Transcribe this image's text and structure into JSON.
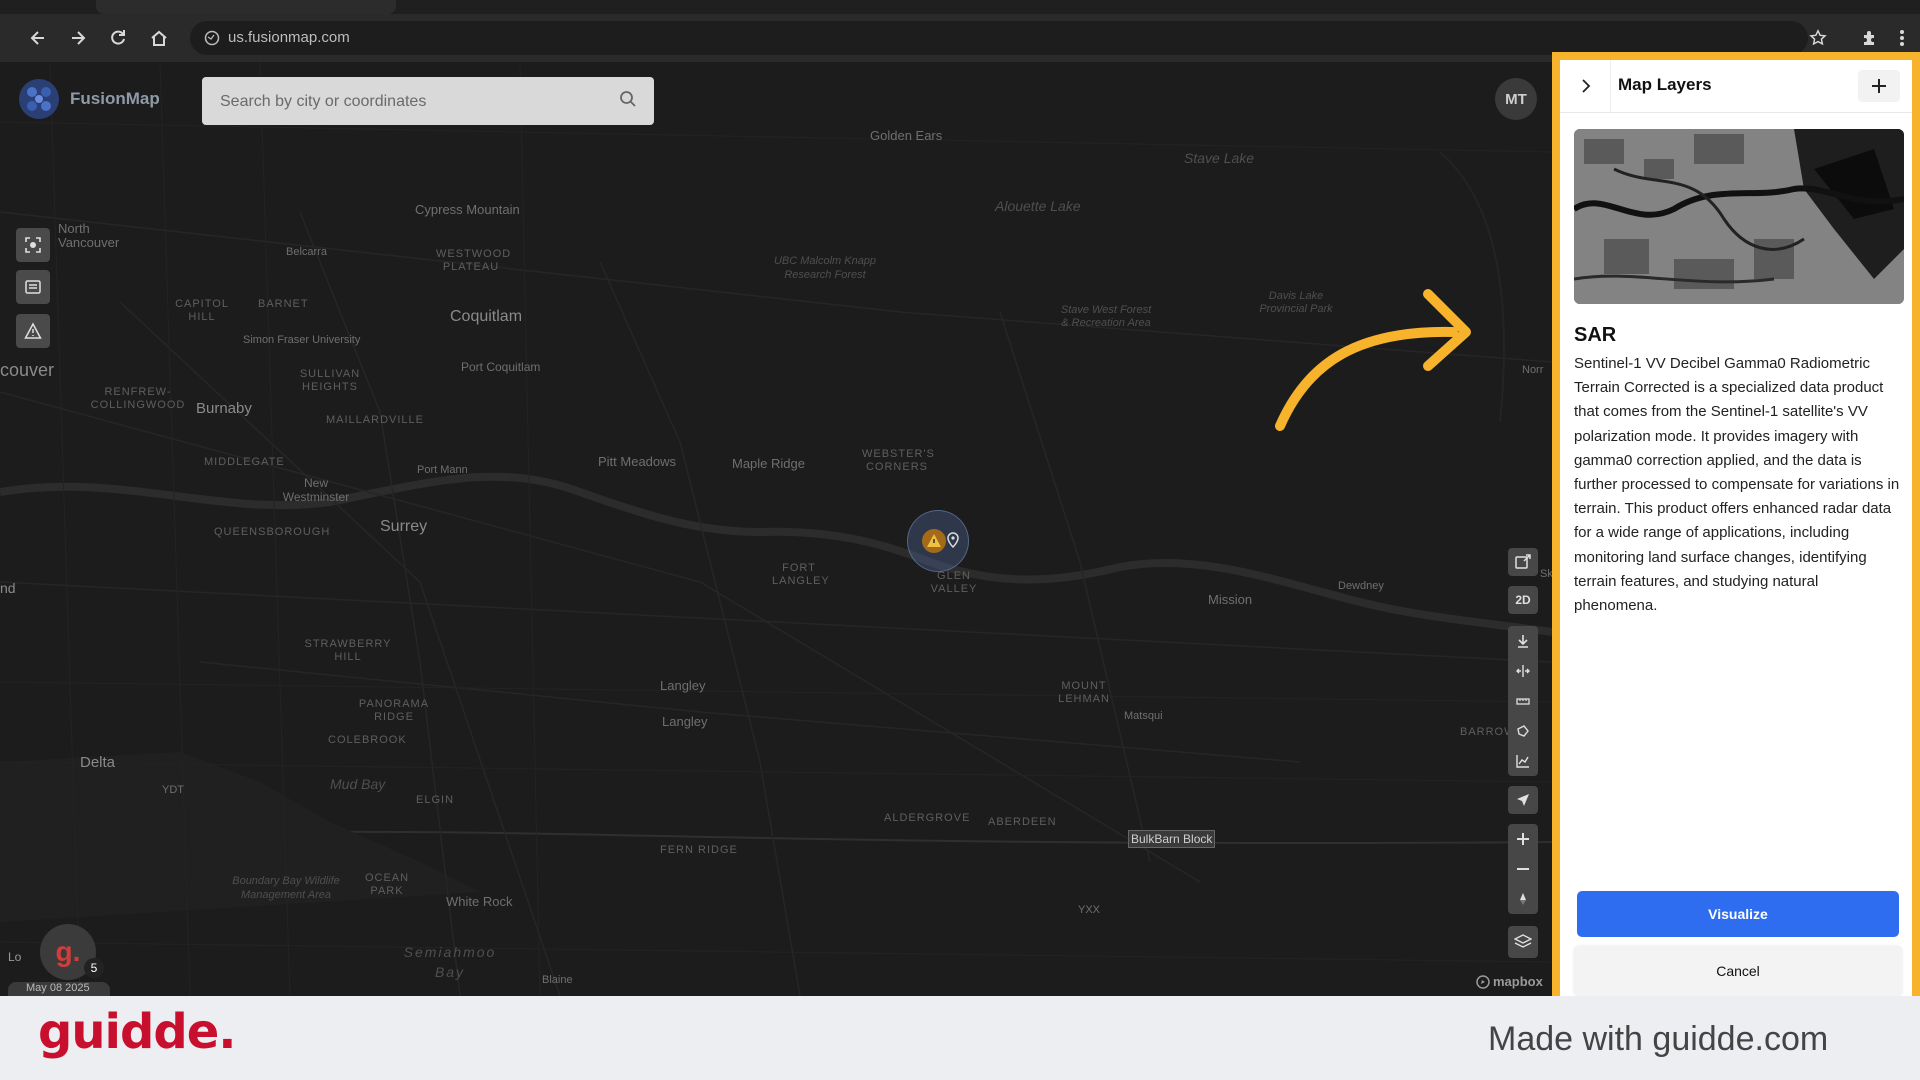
{
  "browser": {
    "url": "us.fusionmap.com",
    "icons": [
      "back-icon",
      "forward-icon",
      "reload-icon",
      "home-icon",
      "site-info-icon",
      "star-icon",
      "extensions-icon",
      "menu-icon"
    ]
  },
  "app": {
    "logo_text": "FusionMap",
    "search_placeholder": "Search by city or coordinates",
    "avatar_initials": "MT"
  },
  "map": {
    "places": [
      "Golden Ears",
      "Stave Lake",
      "Cypress Mountain",
      "Alouette Lake",
      "North Vancouver",
      "Belcarra",
      "WESTWOOD PLATEAU",
      "UBC Malcolm Knapp Research Forest",
      "Davis Lake Provincial Park",
      "Stave West Forest & Recreation Area",
      "CAPITOL HILL",
      "BARNET",
      "Coquitlam",
      "Simon Fraser University",
      "couver",
      "SULLIVAN HEIGHTS",
      "Port Coquitlam",
      "RENFREW-COLLINGWOOD",
      "Burnaby",
      "MAILLARDVILLE",
      "Pitt Meadows",
      "Maple Ridge",
      "WEBSTER'S CORNERS",
      "MIDDLEGATE",
      "Port Mann",
      "New Westminster",
      "QUEENSBOROUGH",
      "Surrey",
      "FORT LANGLEY",
      "GLEN VALLEY",
      "Mission",
      "Dewdney",
      "nd",
      "STRAWBERRY HILL",
      "Langley",
      "Langley",
      "MOUNT LEHMAN",
      "Matsqui",
      "PANORAMA RIDGE",
      "COLEBROOK",
      "Delta",
      "Mud Bay",
      "YDT",
      "ELGIN",
      "ALDERGROVE",
      "ABERDEEN",
      "BARROW",
      "FERN RIDGE",
      "Boundary Bay Wildlife Management Area",
      "OCEAN PARK",
      "White Rock",
      "YXX",
      "Semiahmoo Bay",
      "Blaine",
      "Norr",
      "Sk"
    ],
    "marker_label": "BulkBarn Block",
    "attribution": "mapbox",
    "badge_letter": "g.",
    "badge_count": "5",
    "logo_alt": "Lo",
    "date_text": "May 08 2025",
    "controls": {
      "mode_2d": "2D"
    }
  },
  "panel": {
    "title": "Map Layers",
    "layer_name": "SAR",
    "layer_description": "Sentinel-1 VV Decibel Gamma0 Radiometric Terrain Corrected is a specialized data product that comes from the Sentinel-1 satellite's VV polarization mode. It provides imagery with gamma0 correction applied, and the data is further processed to compensate for variations in terrain. This product offers enhanced radar data for a wide range of applications, including monitoring land surface changes, identifying terrain features, and studying natural phenomena.",
    "visualize_label": "Visualize",
    "cancel_label": "Cancel"
  },
  "footer": {
    "brand": "guidde.",
    "made_with": "Made with guidde.com"
  },
  "colors": {
    "accent_orange": "#f7b32b",
    "visualize_blue": "#2f6df0",
    "brand_red": "#c8102e"
  }
}
